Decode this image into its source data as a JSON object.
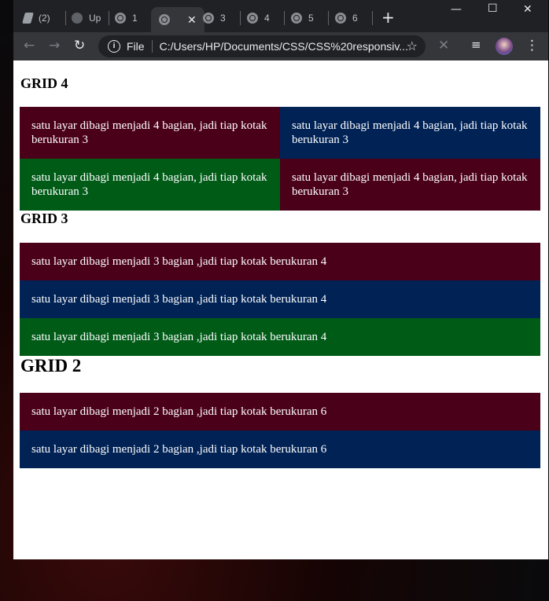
{
  "browser": {
    "tabs": [
      {
        "label": "(2)",
        "icon": "document-icon"
      },
      {
        "label": "Up",
        "icon": "github-icon"
      },
      {
        "label": "1",
        "icon": "globe-icon"
      },
      {
        "label": "",
        "icon": "globe-icon",
        "active": true
      },
      {
        "label": "3",
        "icon": "globe-icon"
      },
      {
        "label": "4",
        "icon": "globe-icon"
      },
      {
        "label": "5",
        "icon": "globe-icon"
      },
      {
        "label": "6",
        "icon": "globe-icon"
      }
    ],
    "address": {
      "scheme_label": "File",
      "url": "C:/Users/HP/Documents/CSS/CSS%20responsiv..."
    }
  },
  "page": {
    "grid4": {
      "heading": "GRID 4",
      "boxes": [
        {
          "text": "satu layar dibagi menjadi 4 bagian, jadi tiap kotak berukuran 3",
          "color": "#4a0019"
        },
        {
          "text": "satu layar dibagi menjadi 4 bagian, jadi tiap kotak berukuran 3",
          "color": "#002255"
        },
        {
          "text": "satu layar dibagi menjadi 4 bagian, jadi tiap kotak berukuran 3",
          "color": "#005b17"
        },
        {
          "text": "satu layar dibagi menjadi 4 bagian, jadi tiap kotak berukuran 3",
          "color": "#4a0019"
        }
      ]
    },
    "grid3": {
      "heading": "GRID 3",
      "boxes": [
        {
          "text": "satu layar dibagi menjadi 3 bagian ,jadi tiap kotak berukuran 4",
          "color": "#4a0019"
        },
        {
          "text": "satu layar dibagi menjadi 3 bagian ,jadi tiap kotak berukuran 4",
          "color": "#002255"
        },
        {
          "text": "satu layar dibagi menjadi 3 bagian ,jadi tiap kotak berukuran 4",
          "color": "#005b17"
        }
      ]
    },
    "grid2": {
      "heading": "GRID 2",
      "boxes": [
        {
          "text": "satu layar dibagi menjadi 2 bagian ,jadi tiap kotak berukuran 6",
          "color": "#4a0019"
        },
        {
          "text": "satu layar dibagi menjadi 2 bagian ,jadi tiap kotak berukuran 6",
          "color": "#002255"
        }
      ]
    }
  }
}
